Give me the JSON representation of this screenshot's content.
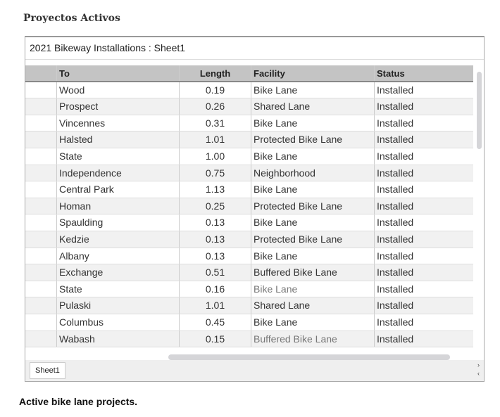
{
  "page_title": "Proyectos Activos",
  "window_title": "2021 Bikeway Installations : Sheet1",
  "columns": [
    "To",
    "Length",
    "Facility",
    "Status"
  ],
  "rows": [
    [
      "Wood",
      "0.19",
      "Bike Lane",
      "Installed"
    ],
    [
      "Prospect",
      "0.26",
      "Shared Lane",
      "Installed"
    ],
    [
      "Vincennes",
      "0.31",
      "Bike Lane",
      "Installed"
    ],
    [
      "Halsted",
      "1.01",
      "Protected Bike Lane",
      "Installed"
    ],
    [
      "State",
      "1.00",
      "Bike Lane",
      "Installed"
    ],
    [
      "Independence",
      "0.75",
      "Neighborhood",
      "Installed"
    ],
    [
      "Central Park",
      "1.13",
      "Bike Lane",
      "Installed"
    ],
    [
      "Homan",
      "0.25",
      "Protected Bike Lane",
      "Installed"
    ],
    [
      "Spaulding",
      "0.13",
      "Bike Lane",
      "Installed"
    ],
    [
      "Kedzie",
      "0.13",
      "Protected Bike Lane",
      "Installed"
    ],
    [
      "Albany",
      "0.13",
      "Bike Lane",
      "Installed"
    ],
    [
      "Exchange",
      "0.51",
      "Buffered Bike Lane",
      "Installed"
    ],
    [
      "State",
      "0.16",
      "Bike Lane",
      "Installed"
    ],
    [
      "Pulaski",
      "1.01",
      "Shared Lane",
      "Installed"
    ],
    [
      "Columbus",
      "0.45",
      "Bike Lane",
      "Installed"
    ],
    [
      "Wabash",
      "0.15",
      "Buffered Bike Lane",
      "Installed"
    ]
  ],
  "sheet_tab": "Sheet1",
  "caption": "Active bike lane projects."
}
